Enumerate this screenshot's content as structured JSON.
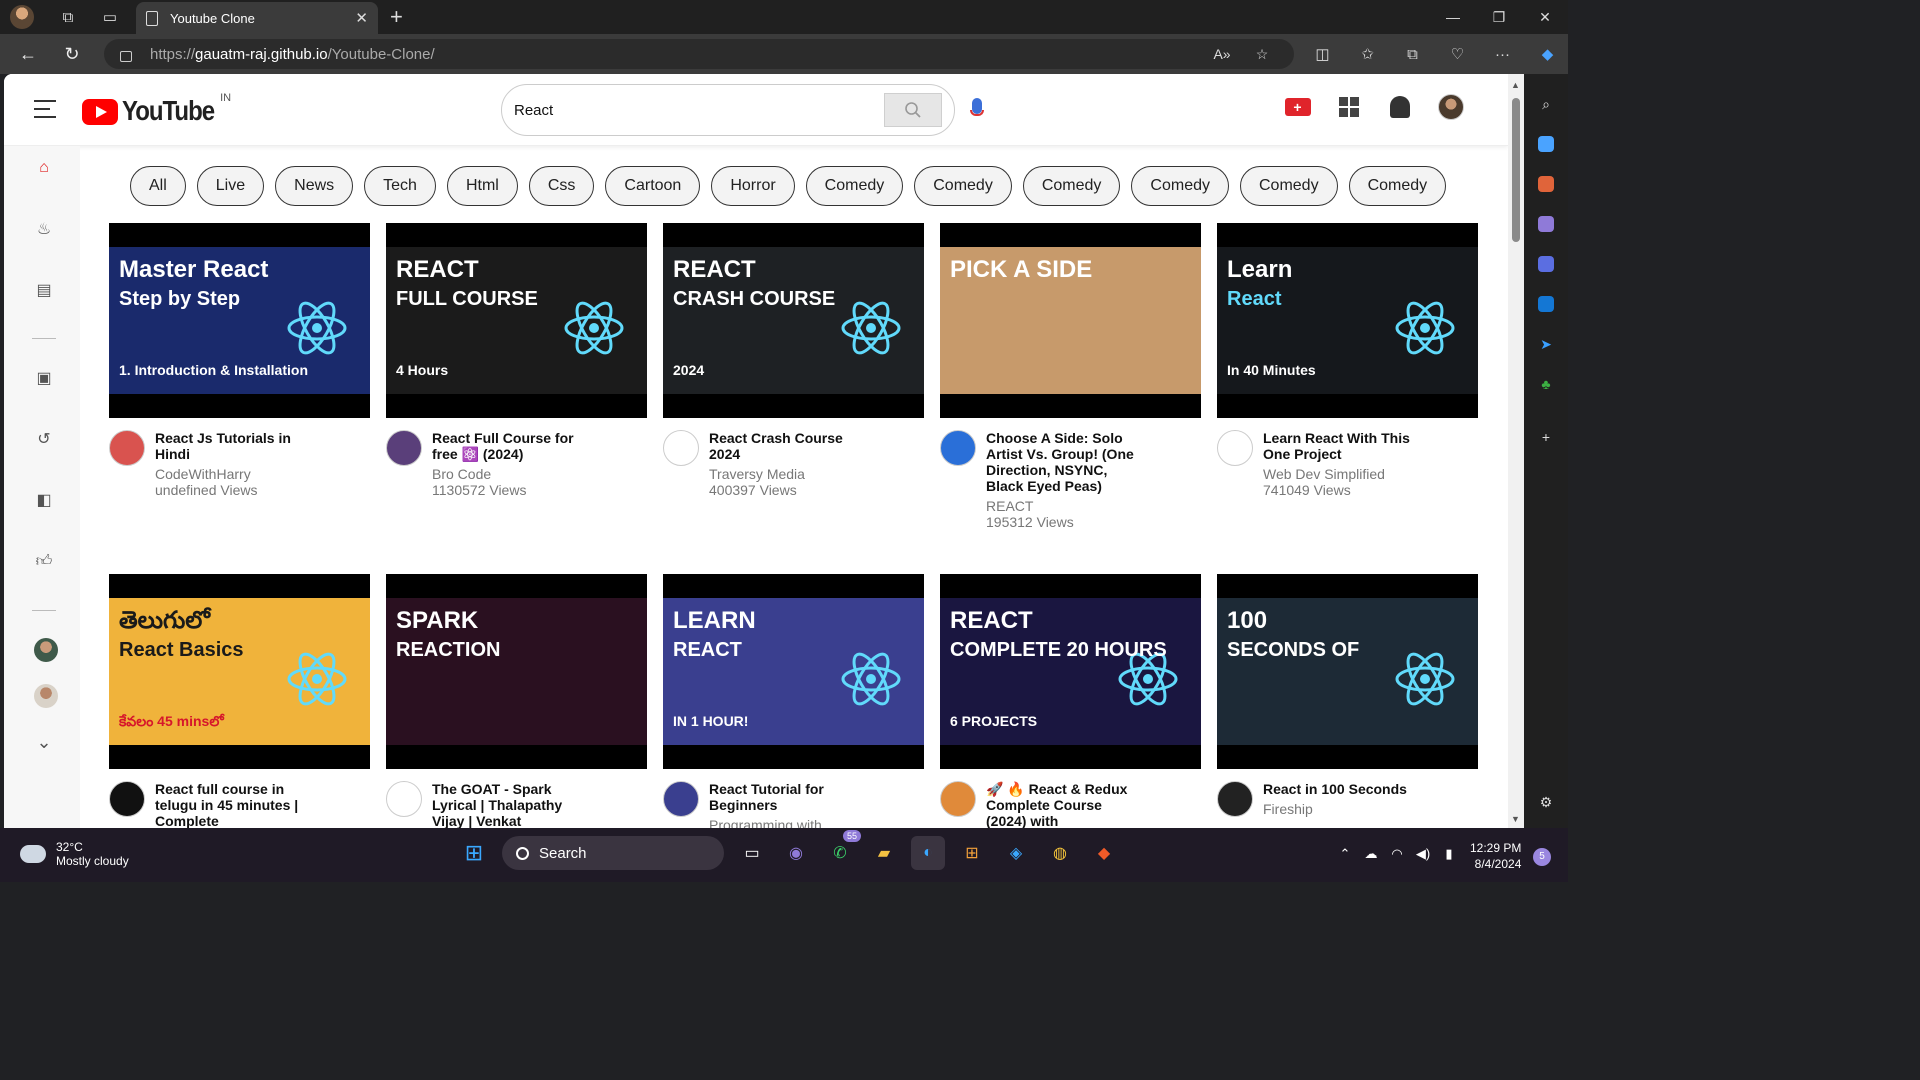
{
  "browser": {
    "tab_title": "Youtube Clone",
    "url_scheme": "https://",
    "url_host": "gauatm-raj.github.io",
    "url_path": "/Youtube-Clone/"
  },
  "header": {
    "logo_text": "YouTube",
    "country_code": "IN",
    "search_value": "React"
  },
  "chips": [
    "All",
    "Live",
    "News",
    "Tech",
    "Html",
    "Css",
    "Cartoon",
    "Horror",
    "Comedy",
    "Comedy",
    "Comedy",
    "Comedy",
    "Comedy",
    "Comedy"
  ],
  "videos": [
    {
      "title": "React Js Tutorials in Hindi",
      "channel": "CodeWithHarry",
      "views": "undefined Views",
      "thumb_text": "Master React",
      "thumb_sub": "Step by Step",
      "thumb_foot": "1. Introduction & Installation",
      "bg": "#1a2a6c"
    },
    {
      "title": "React Full Course for free ⚛️ (2024)",
      "channel": "Bro Code",
      "views": "1130572 Views",
      "thumb_text": "REACT",
      "thumb_sub": "FULL COURSE",
      "thumb_foot": "4 Hours",
      "bg": "#1b1b1b"
    },
    {
      "title": "React Crash Course 2024",
      "channel": "Traversy Media",
      "views": "400397 Views",
      "thumb_text": "REACT",
      "thumb_sub": "CRASH COURSE",
      "thumb_foot": "2024",
      "bg": "#1e2124"
    },
    {
      "title": "Choose A Side: Solo Artist Vs. Group! (One Direction, NSYNC, Black Eyed Peas)",
      "channel": "REACT",
      "views": "195312 Views",
      "thumb_text": "PICK A SIDE",
      "thumb_sub": "",
      "thumb_foot": "",
      "bg": "#c79a6b"
    },
    {
      "title": "Learn React With This One Project",
      "channel": "Web Dev Simplified",
      "views": "741049 Views",
      "thumb_text": "Learn",
      "thumb_sub": "React",
      "thumb_foot": "In 40 Minutes",
      "bg": "#15181c"
    },
    {
      "title": "React full course in telugu in 45 minutes | Complete",
      "channel": "",
      "views": "",
      "thumb_text": "తెలుగులో",
      "thumb_sub": "React Basics",
      "thumb_foot": "కేవలం 45 minsలో",
      "bg": "#f0b33b"
    },
    {
      "title": "The GOAT - Spark Lyrical | Thalapathy Vijay | Venkat",
      "channel": "",
      "views": "",
      "thumb_text": "SPARK",
      "thumb_sub": "REACTION",
      "thumb_foot": "",
      "bg": "#2a1020"
    },
    {
      "title": "React Tutorial for Beginners",
      "channel": "Programming with",
      "views": "",
      "thumb_text": "LEARN",
      "thumb_sub": "REACT",
      "thumb_foot": "IN 1 HOUR!",
      "bg": "#3a3f8f"
    },
    {
      "title": "🚀 🔥 React & Redux Complete Course (2024) with",
      "channel": "",
      "views": "",
      "thumb_text": "REACT",
      "thumb_sub": "COMPLETE 20 HOURS",
      "thumb_foot": "6 PROJECTS",
      "bg": "#1a1640"
    },
    {
      "title": "React in 100 Seconds",
      "channel": "Fireship",
      "views": "",
      "thumb_text": "100",
      "thumb_sub": "SECONDS OF",
      "thumb_foot": "",
      "bg": "#1d2a36"
    }
  ],
  "taskbar": {
    "temp": "32°C",
    "weather": "Mostly cloudy",
    "search_label": "Search",
    "whatsapp_badge": "55",
    "time": "12:29 PM",
    "date": "8/4/2024",
    "notif_count": "5"
  },
  "colors": {
    "accent_red": "#ff0000",
    "react_blue": "#61dafb"
  }
}
